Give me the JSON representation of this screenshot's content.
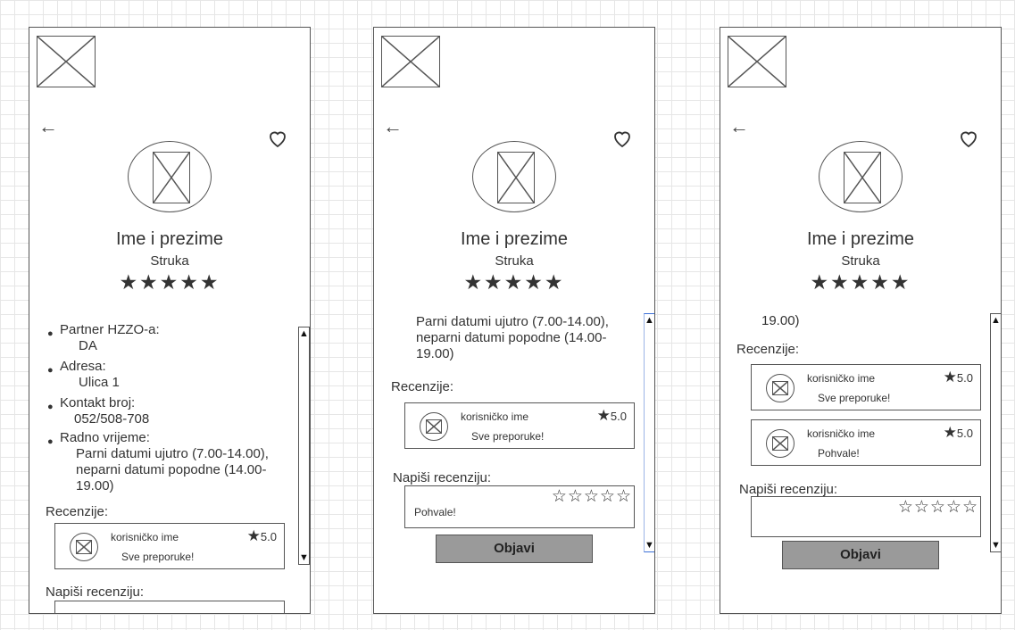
{
  "profile": {
    "name": "Ime i prezime",
    "profession": "Struka",
    "rating_stars": "★★★★★",
    "back_glyph": "←",
    "favorite_icon": "heart-icon"
  },
  "details": {
    "partner_label": "Partner HZZO-a:",
    "partner_value": "DA",
    "address_label": "Adresa:",
    "address_value": "Ulica 1",
    "contact_label": "Kontakt broj:",
    "contact_value": "052/508-708",
    "hours_label": "Radno vrijeme:",
    "hours_line1": "Parni datumi ujutro (7.00-14.00),",
    "hours_line2": "neparni datumi popodne (14.00-",
    "hours_line3": "19.00)"
  },
  "reviews": {
    "heading": "Recenzije:",
    "items": [
      {
        "user": "korisničko ime",
        "score": "5.0",
        "comment": "Sve preporuke!"
      },
      {
        "user": "korisničko ime",
        "score": "5.0",
        "comment": "Pohvale!"
      }
    ],
    "star_glyph": "★"
  },
  "write_review": {
    "label": "Napiši recenziju:",
    "empty_stars": "☆☆☆☆☆",
    "typed_value": "Pohvale!",
    "submit_label": "Objavi"
  },
  "scroll": {
    "up": "▲",
    "down": "▼"
  },
  "bullet_glyph": "●"
}
